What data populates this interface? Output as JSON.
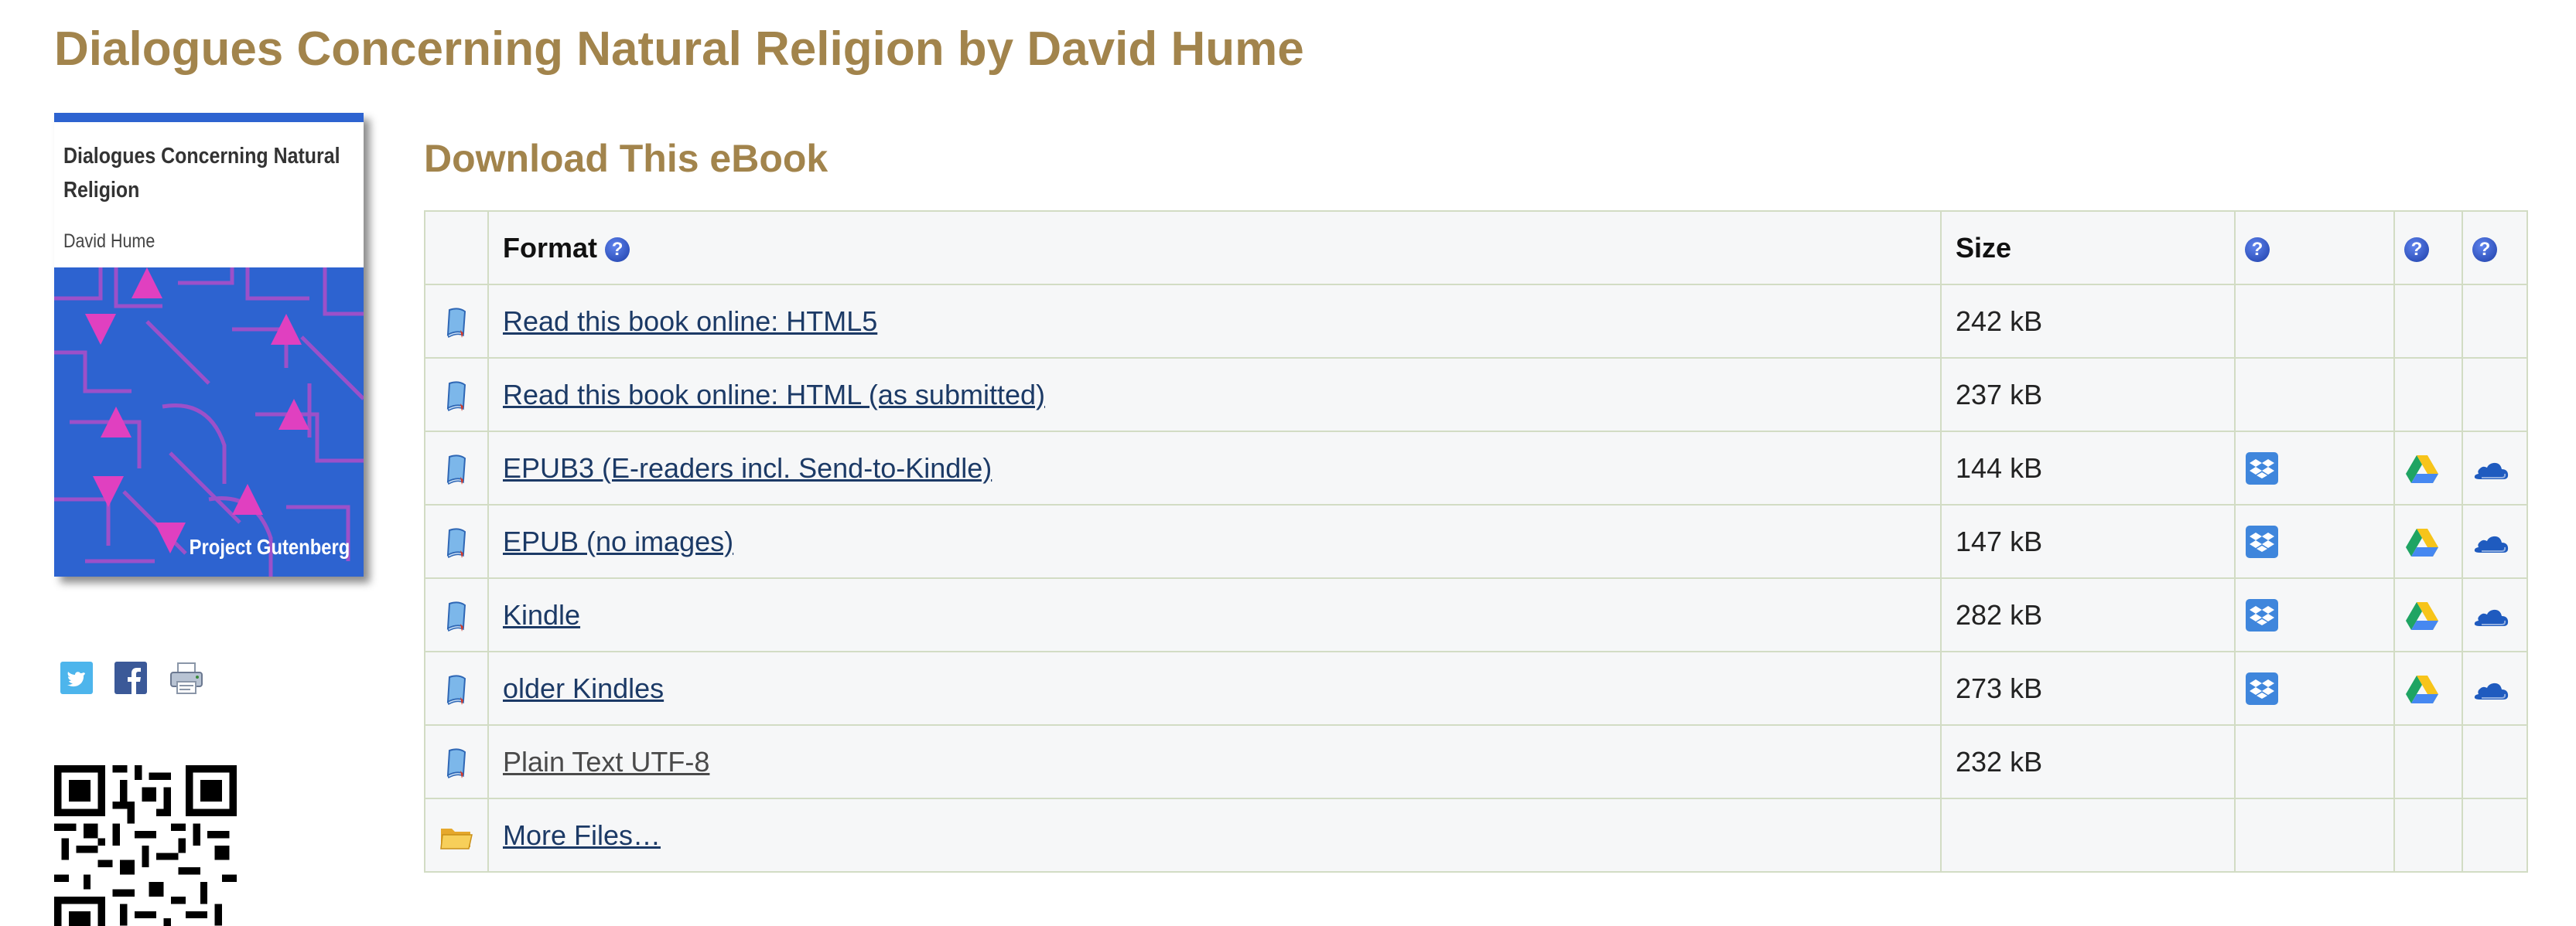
{
  "book": {
    "title": "Dialogues Concerning Natural Religion by David Hume",
    "cover": {
      "title": "Dialogues Concerning Natural Religion",
      "author": "David Hume",
      "brand": "Project Gutenberg",
      "color": "#2d63d0",
      "accent": "#e040c0"
    }
  },
  "share": {
    "icons": [
      "twitter-icon",
      "facebook-icon",
      "print-icon"
    ]
  },
  "download": {
    "heading": "Download This eBook",
    "headers": {
      "format": "Format",
      "size": "Size"
    },
    "rows": [
      {
        "icon": "book-icon",
        "label": "Read this book online: HTML5",
        "size": "242 kB",
        "services": false,
        "plain": false
      },
      {
        "icon": "book-icon",
        "label": "Read this book online: HTML (as submitted)",
        "size": "237 kB",
        "services": false,
        "plain": false
      },
      {
        "icon": "book-icon",
        "label": "EPUB3 (E-readers incl. Send-to-Kindle)",
        "size": "144 kB",
        "services": true,
        "plain": false
      },
      {
        "icon": "book-icon",
        "label": "EPUB (no images)",
        "size": "147 kB",
        "services": true,
        "plain": false
      },
      {
        "icon": "book-icon",
        "label": "Kindle",
        "size": "282 kB",
        "services": true,
        "plain": false
      },
      {
        "icon": "book-icon",
        "label": "older Kindles",
        "size": "273 kB",
        "services": true,
        "plain": false
      },
      {
        "icon": "book-icon",
        "label": "Plain Text UTF-8",
        "size": "232 kB",
        "services": false,
        "plain": true
      },
      {
        "icon": "folder-icon",
        "label": "More Files…",
        "size": "",
        "services": false,
        "plain": false
      }
    ],
    "service_icons": [
      "dropbox-icon",
      "google-drive-icon",
      "onedrive-icon"
    ]
  },
  "colors": {
    "title": "#a2844c",
    "link": "#1c3a66",
    "table_bg": "#f6f7f8",
    "table_border": "#d2dcc4"
  }
}
